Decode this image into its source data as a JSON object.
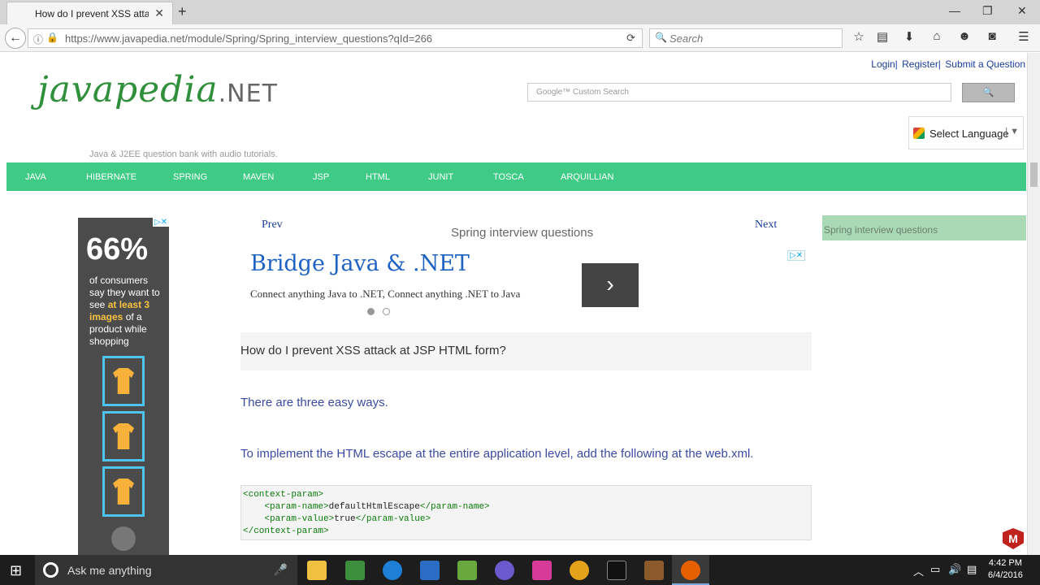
{
  "browser": {
    "tab_title": "How do I prevent XSS atta...",
    "url": "https://www.javapedia.net/module/Spring/Spring_interview_questions?qId=266",
    "search_placeholder": "Search"
  },
  "header": {
    "links": [
      "Login|",
      "Register|",
      "Submit a Question"
    ],
    "logo_main": "javapedia",
    "logo_suffix": ".NET",
    "tagline": "Java & J2EE question bank with audio tutorials.",
    "search_placeholder": "Google™ Custom Search",
    "language_label": "Select Language"
  },
  "menu": [
    "JAVA",
    "HIBERNATE",
    "SPRING",
    "MAVEN",
    "JSP",
    "HTML",
    "JUNIT",
    "TOSCA",
    "ARQUILLIAN"
  ],
  "ad_left": {
    "big": "66%",
    "line1": "of consumers say they want to see",
    "highlight": "at least 3 images",
    "line2": "of a product while shopping"
  },
  "content": {
    "prev": "Prev",
    "next": "Next",
    "breadcrumb": "Spring interview questions",
    "ad_title": "Bridge Java & .NET",
    "ad_subtitle": "Connect anything Java to .NET, Connect anything .NET to Java",
    "question": "How do I prevent XSS attack at JSP HTML form?",
    "para1": "There are three easy ways.",
    "para2": "To implement the HTML escape at the entire application level, add the following at the web.xml.",
    "code": {
      "l1_open": "<context-param>",
      "l2_open": "<param-name>",
      "l2_val": "defaultHtmlEscape",
      "l2_close": "</param-name>",
      "l3_open": "<param-value>",
      "l3_val": "true",
      "l3_close": "</param-value>",
      "l4_close": "</context-param>"
    }
  },
  "sidebar": {
    "title": "Spring interview questions"
  },
  "taskbar": {
    "search_text": "Ask me anything",
    "time": "4:42 PM",
    "date": "6/4/2016"
  }
}
